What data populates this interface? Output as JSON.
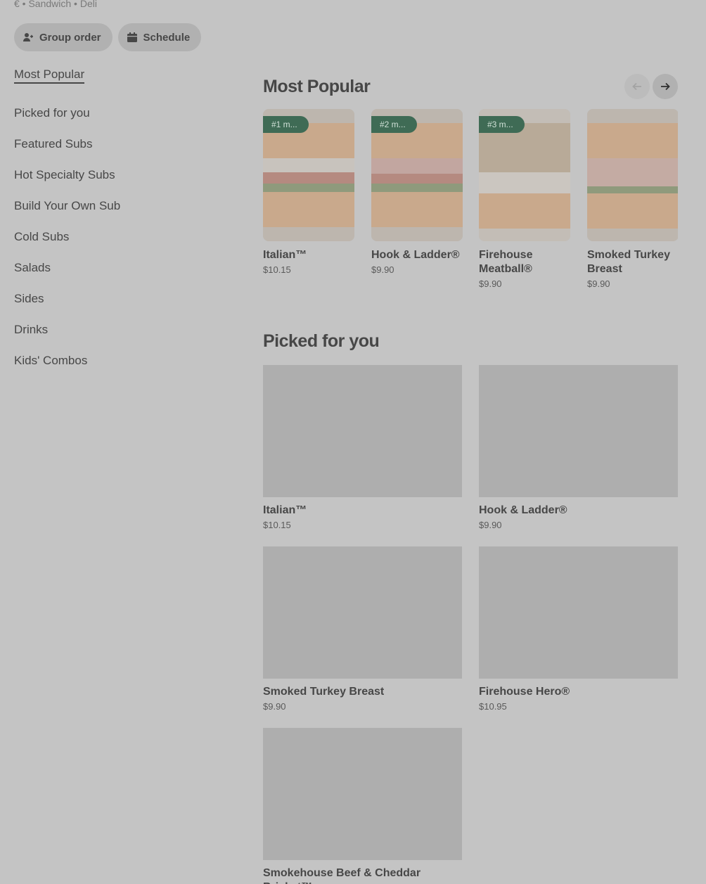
{
  "store": {
    "meta": "€ • Sandwich • Deli"
  },
  "actions": {
    "group_order": "Group order",
    "schedule": "Schedule"
  },
  "sidebar": {
    "items": [
      {
        "label": "Most Popular"
      },
      {
        "label": "Picked for you"
      },
      {
        "label": "Featured Subs"
      },
      {
        "label": "Hot Specialty Subs"
      },
      {
        "label": "Build Your Own Sub"
      },
      {
        "label": "Cold Subs"
      },
      {
        "label": "Salads"
      },
      {
        "label": "Sides"
      },
      {
        "label": "Drinks"
      },
      {
        "label": "Kids' Combos"
      }
    ]
  },
  "most_popular": {
    "title": "Most Popular",
    "items": [
      {
        "badge": "#1 m...",
        "name": "Italian™",
        "price": "$10.15"
      },
      {
        "badge": "#2 m...",
        "name": "Hook & Ladder®",
        "price": "$9.90"
      },
      {
        "badge": "#3 m...",
        "name": "Firehouse Meatball®",
        "price": "$9.90"
      },
      {
        "name": "Smoked Turkey Breast",
        "price": "$9.90"
      }
    ]
  },
  "picked_for_you": {
    "title": "Picked for you",
    "items": [
      {
        "name": "Italian™",
        "price": "$10.15"
      },
      {
        "name": "Hook & Ladder®",
        "price": "$9.90"
      },
      {
        "name": "Smoked Turkey Breast",
        "price": "$9.90"
      },
      {
        "name": "Firehouse Hero®",
        "price": "$10.95"
      },
      {
        "name": "Smokehouse Beef & Cheddar Brisket™"
      }
    ]
  },
  "colors": {
    "badge": "#3f6b55",
    "overlay_background": "#c4c4c4"
  }
}
